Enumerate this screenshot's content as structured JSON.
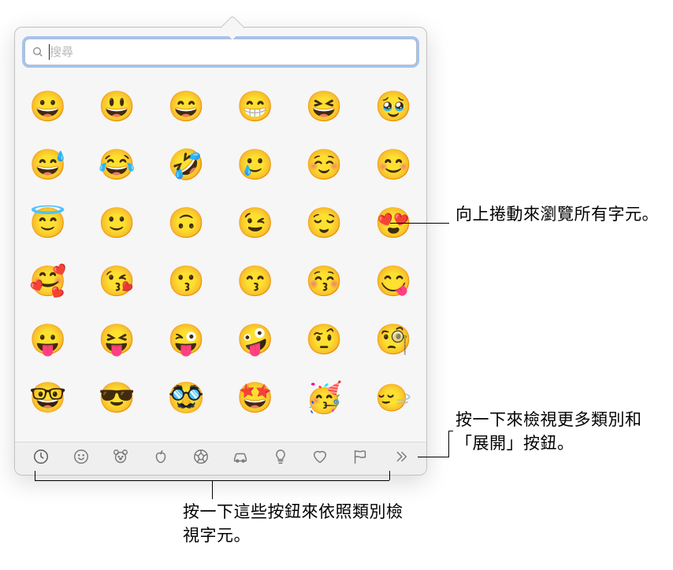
{
  "search": {
    "placeholder": "搜尋"
  },
  "emojis": [
    [
      "😀",
      "😃",
      "😄",
      "😁",
      "😆",
      "🥹"
    ],
    [
      "😅",
      "😂",
      "🤣",
      "🥲",
      "☺️",
      "😊"
    ],
    [
      "😇",
      "🙂",
      "🙃",
      "😉",
      "😌",
      "😍"
    ],
    [
      "🥰",
      "😘",
      "😗",
      "😙",
      "😚",
      "😋"
    ],
    [
      "😛",
      "😝",
      "😜",
      "🤪",
      "🤨",
      "🧐"
    ],
    [
      "🤓",
      "😎",
      "🥸",
      "🤩",
      "🥳",
      "🙂‍↔️"
    ]
  ],
  "categories": [
    {
      "name": "frequently-used",
      "icon": "clock"
    },
    {
      "name": "smileys-people",
      "icon": "smiley"
    },
    {
      "name": "animals-nature",
      "icon": "animal"
    },
    {
      "name": "food-drink",
      "icon": "apple"
    },
    {
      "name": "activity",
      "icon": "soccer"
    },
    {
      "name": "travel-places",
      "icon": "car"
    },
    {
      "name": "objects",
      "icon": "bulb"
    },
    {
      "name": "symbols",
      "icon": "heart"
    },
    {
      "name": "flags",
      "icon": "flag"
    },
    {
      "name": "more",
      "icon": "more"
    }
  ],
  "callouts": {
    "scroll": "向上捲動來瀏覽所有字元。",
    "more": "按一下來檢視更多類別和「展開」按鈕。",
    "categories": "按一下這些按鈕來依照類別檢視字元。"
  }
}
